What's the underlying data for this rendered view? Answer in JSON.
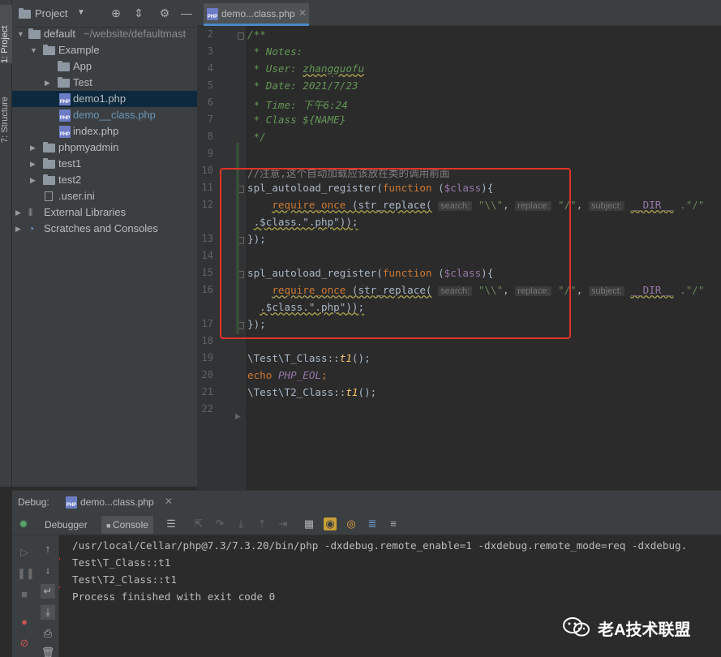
{
  "toolstrip": {
    "project_tab": "1: Project",
    "structure_tab": "7: Structure"
  },
  "project_panel": {
    "title": "Project",
    "tree": [
      {
        "label": "default",
        "suffix": "~/website/defaultmast",
        "kind": "folder",
        "depth": 0,
        "expanded": true
      },
      {
        "label": "Example",
        "kind": "folder",
        "depth": 1,
        "expanded": true
      },
      {
        "label": "App",
        "kind": "folder",
        "depth": 2,
        "expanded": null
      },
      {
        "label": "Test",
        "kind": "folder",
        "depth": 2,
        "expanded": false
      },
      {
        "label": "demo1.php",
        "kind": "php",
        "depth": 2,
        "selected": true
      },
      {
        "label": "demo__class.php",
        "kind": "php",
        "depth": 2
      },
      {
        "label": "index.php",
        "kind": "php",
        "depth": 2
      },
      {
        "label": "phpmyadmin",
        "kind": "folder",
        "depth": 1,
        "expanded": false
      },
      {
        "label": "test1",
        "kind": "folder",
        "depth": 1,
        "expanded": false
      },
      {
        "label": "test2",
        "kind": "folder",
        "depth": 1,
        "expanded": false
      },
      {
        "label": ".user.ini",
        "kind": "file",
        "depth": 1
      },
      {
        "label": "External Libraries",
        "kind": "lib",
        "depth": 0,
        "expanded": false
      },
      {
        "label": "Scratches and Consoles",
        "kind": "scratch",
        "depth": 0,
        "expanded": false
      }
    ]
  },
  "editor": {
    "tab_label": "demo...class.php",
    "line_numbers": [
      "2",
      "3",
      "4",
      "5",
      "6",
      "7",
      "8",
      "9",
      "10",
      "11",
      "12",
      "",
      "13",
      "14",
      "15",
      "16",
      "",
      "17",
      "18",
      "19",
      "20",
      "21",
      "22"
    ],
    "comment_block": {
      "open": "/**",
      "notes": " * Notes:",
      "user_key": " * User: ",
      "user_val": "zhangguofu",
      "date_key": " * Date: ",
      "date_val": "2021/7/23",
      "time_key": " * Time: ",
      "time_val": "下午6:24",
      "class_key": " * Class ",
      "class_val": "${NAME}",
      "close": " */"
    },
    "line_comment": "//注意,这个自动加载应该放在类的调用前面",
    "autoload": {
      "fn": "spl_autoload_register",
      "paren_open": "(",
      "kw_function": "function",
      "arg": " ($class){",
      "arg_var": "$class",
      "require": "require_once",
      "str_replace": " (str_replace(",
      "hint_search": "search:",
      "hint_replace": "replace:",
      "hint_subject": "subject:",
      "backslash": "\"\\\\\"",
      "slash": "\"/\"",
      "dir": "__DIR__",
      "concat": ".\"/\"",
      "cont": ".$class.\".php\"));",
      "close": "});"
    },
    "calls": [
      {
        "prefix": "\\Test\\",
        "cls": "T_Class",
        "sep": "::",
        "method": "t1",
        "tail": "();"
      },
      {
        "echo": "echo",
        "const": "PHP_EOL",
        "tail": ";"
      },
      {
        "prefix": "\\Test\\",
        "cls": "T2_Class",
        "sep": "::",
        "method": "t1",
        "tail": "();"
      }
    ]
  },
  "debug": {
    "label": "Debug:",
    "config": "demo...class.php",
    "tabs": {
      "debugger": "Debugger",
      "console": "Console"
    },
    "console_lines": [
      "/usr/local/Cellar/php@7.3/7.3.20/bin/php -dxdebug.remote_enable=1 -dxdebug.remote_mode=req -dxdebug.",
      "Test\\T_Class::t1",
      "Test\\T2_Class::t1",
      "Process finished with exit code 0"
    ]
  },
  "watermark": {
    "text": "老A技术联盟",
    "icon": "wechat-icon"
  },
  "colors": {
    "annotation_red": "#e0332a",
    "selection": "#0d293e",
    "accent": "#4a88c7"
  }
}
